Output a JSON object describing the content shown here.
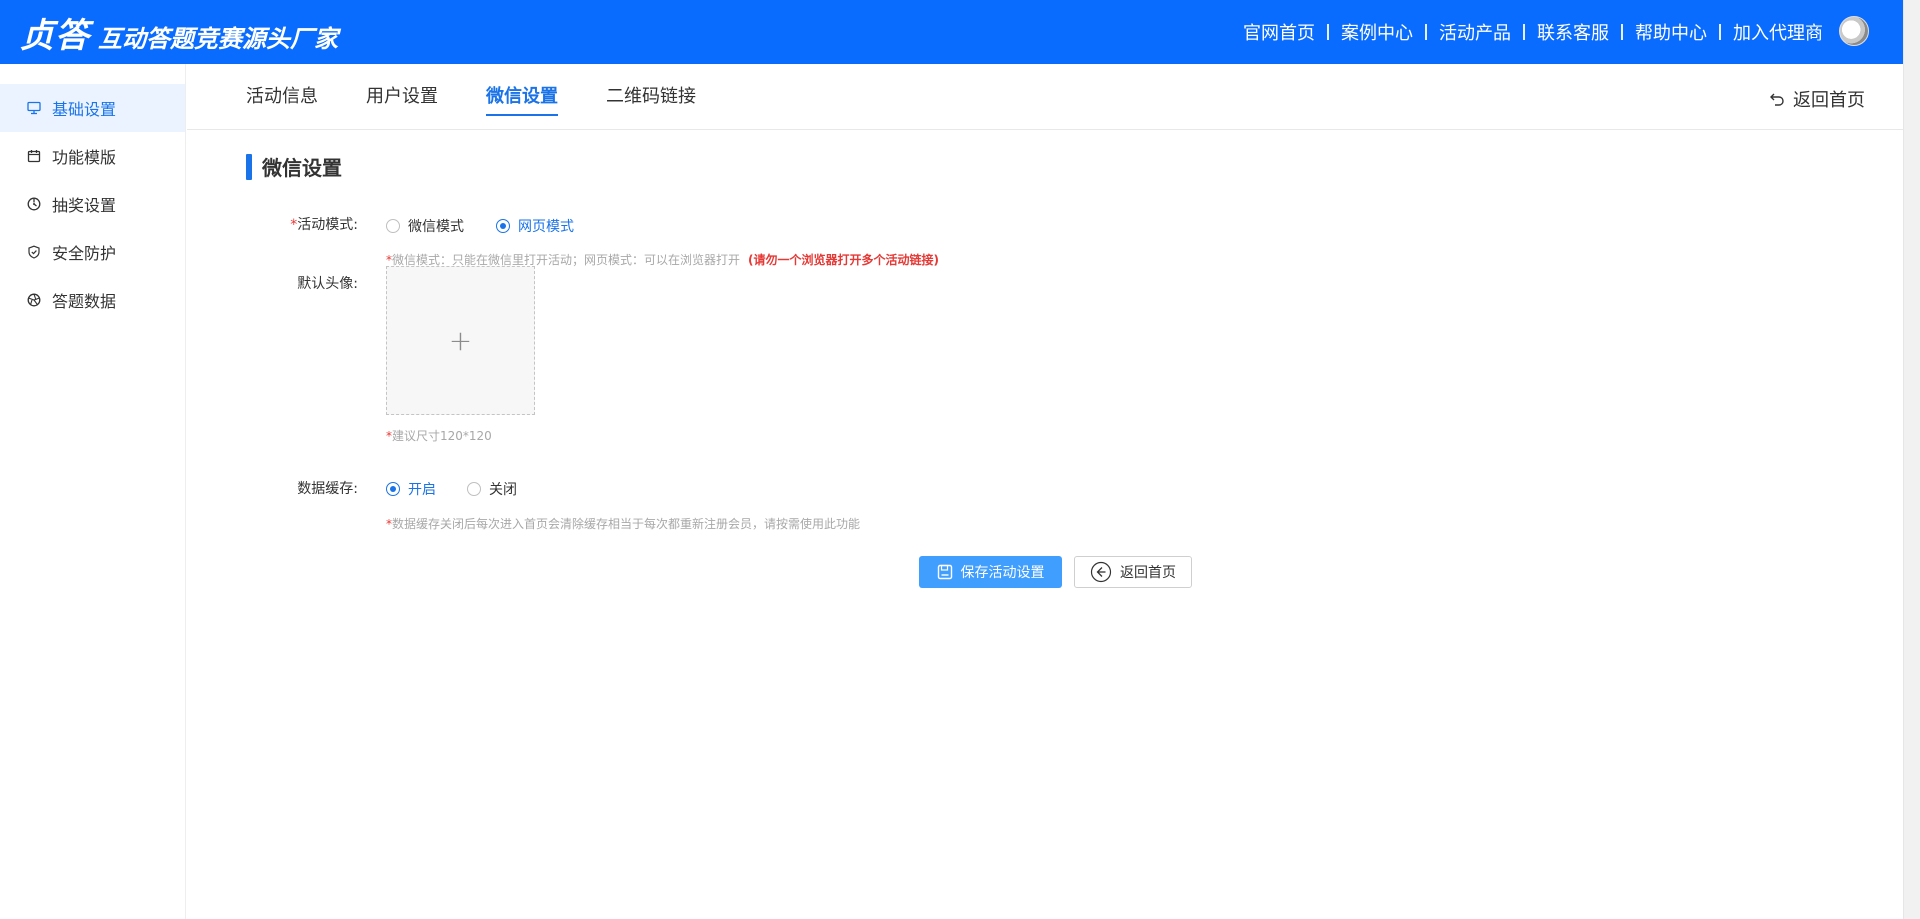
{
  "header": {
    "logo_main": "贞答",
    "logo_sub": "互动答题竞赛源头厂家",
    "nav": [
      "官网首页",
      "案例中心",
      "活动产品",
      "联系客服",
      "帮助中心",
      "加入代理商"
    ]
  },
  "sidebar": {
    "items": [
      {
        "label": "基础设置",
        "icon": "monitor-icon",
        "active": true
      },
      {
        "label": "功能模版",
        "icon": "calendar-icon"
      },
      {
        "label": "抽奖设置",
        "icon": "wheel-icon"
      },
      {
        "label": "安全防护",
        "icon": "shield-icon"
      },
      {
        "label": "答题数据",
        "icon": "aperture-icon"
      }
    ]
  },
  "tabs": {
    "items": [
      "活动信息",
      "用户设置",
      "微信设置",
      "二维码链接"
    ],
    "active": "微信设置",
    "back_home": "返回首页"
  },
  "form": {
    "section_title": "微信设置",
    "mode": {
      "required_mark": "*",
      "label": "活动模式:",
      "options": [
        "微信模式",
        "网页模式"
      ],
      "selected": "网页模式",
      "hint_star": "*",
      "hint": "微信模式：只能在微信里打开活动；网页模式：可以在浏览器打开",
      "hint_warn": "(请勿一个浏览器打开多个活动链接)"
    },
    "avatar": {
      "label": "默认头像:",
      "upload_symbol": "+",
      "hint_star": "*",
      "hint": "建议尺寸120*120"
    },
    "cache": {
      "label": "数据缓存:",
      "options": [
        "开启",
        "关闭"
      ],
      "selected": "开启",
      "hint_star": "*",
      "hint": "数据缓存关闭后每次进入首页会清除缓存相当于每次都重新注册会员，请按需使用此功能"
    }
  },
  "buttons": {
    "save": "保存活动设置",
    "back": "返回首页"
  },
  "colors": {
    "header_bg": "#0a6cff",
    "accent": "#1a73e8",
    "primary_button": "#409eff",
    "required": "#e53935"
  }
}
